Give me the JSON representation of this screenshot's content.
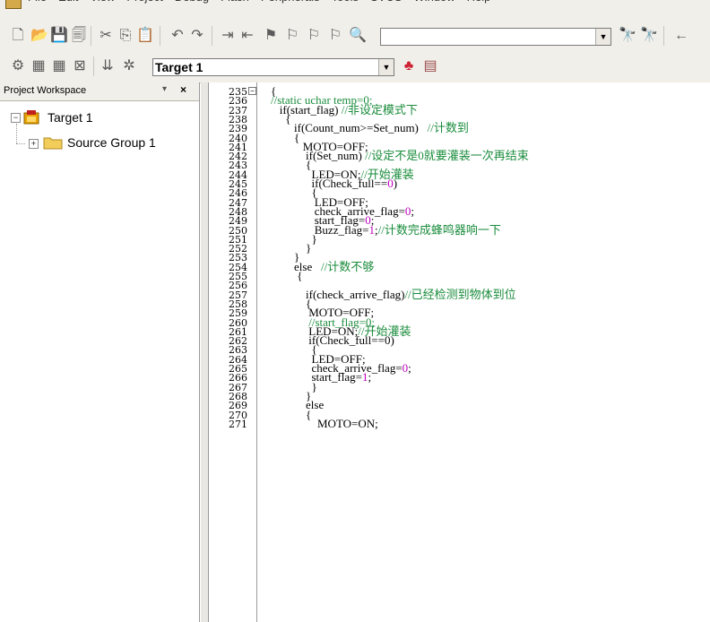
{
  "menu": [
    "File",
    "Edit",
    "View",
    "Project",
    "Debug",
    "Flash",
    "Peripherals",
    "Tools",
    "SVCS",
    "Window",
    "Help"
  ],
  "toolbar": {
    "target_combo": "Target 1",
    "search_combo": ""
  },
  "workspace": {
    "title": "Project Workspace",
    "pin": "▾",
    "close": "×",
    "tree": [
      {
        "label": "Target 1",
        "expander": "−"
      },
      {
        "label": "Source Group 1",
        "expander": "+"
      }
    ]
  },
  "editor": {
    "lines": [
      {
        "n": "235",
        "code": [
          {
            "t": "{",
            "c": "k"
          }
        ]
      },
      {
        "n": "236",
        "code": [
          {
            "t": "//static uchar temp=0;",
            "c": "c"
          }
        ]
      },
      {
        "n": "237",
        "code": [
          {
            "t": "   if(start_flag) ",
            "c": "k"
          },
          {
            "t": "//非设定模式下",
            "c": "c"
          }
        ]
      },
      {
        "n": "238",
        "code": [
          {
            "t": "     {",
            "c": "k"
          }
        ]
      },
      {
        "n": "239",
        "code": [
          {
            "t": "        if(Count_num>=Set_num)   ",
            "c": "k"
          },
          {
            "t": "//计数到",
            "c": "c"
          }
        ]
      },
      {
        "n": "240",
        "code": [
          {
            "t": "        {",
            "c": "k"
          }
        ]
      },
      {
        "n": "241",
        "code": [
          {
            "t": "           MOTO=OFF;",
            "c": "k"
          }
        ]
      },
      {
        "n": "242",
        "code": [
          {
            "t": "            if(Set_num) ",
            "c": "k"
          },
          {
            "t": "//设定不是0就要灌装一次再结束",
            "c": "c"
          }
        ]
      },
      {
        "n": "243",
        "code": [
          {
            "t": "            {",
            "c": "k"
          }
        ]
      },
      {
        "n": "244",
        "code": [
          {
            "t": "              LED=ON;",
            "c": "k"
          },
          {
            "t": "//开始灌装",
            "c": "c"
          }
        ]
      },
      {
        "n": "245",
        "code": [
          {
            "t": "              if(Check_full==",
            "c": "k"
          },
          {
            "t": "0",
            "c": "n"
          },
          {
            "t": ")",
            "c": "k"
          }
        ]
      },
      {
        "n": "246",
        "code": [
          {
            "t": "              {",
            "c": "k"
          }
        ]
      },
      {
        "n": "247",
        "code": [
          {
            "t": "               LED=OFF;",
            "c": "k"
          }
        ]
      },
      {
        "n": "248",
        "code": [
          {
            "t": "               check_arrive_flag=",
            "c": "k"
          },
          {
            "t": "0",
            "c": "n"
          },
          {
            "t": ";",
            "c": "k"
          }
        ]
      },
      {
        "n": "249",
        "code": [
          {
            "t": "               start_flag=",
            "c": "k"
          },
          {
            "t": "0",
            "c": "n"
          },
          {
            "t": ";",
            "c": "k"
          }
        ]
      },
      {
        "n": "250",
        "code": [
          {
            "t": "               Buzz_flag=",
            "c": "k"
          },
          {
            "t": "1",
            "c": "n"
          },
          {
            "t": ";",
            "c": "k"
          },
          {
            "t": "//计数完成蜂鸣器响一下",
            "c": "c"
          }
        ]
      },
      {
        "n": "251",
        "code": [
          {
            "t": "              }",
            "c": "k"
          }
        ]
      },
      {
        "n": "252",
        "code": [
          {
            "t": "            }",
            "c": "k"
          }
        ]
      },
      {
        "n": "253",
        "code": [
          {
            "t": "        }",
            "c": "k"
          }
        ]
      },
      {
        "n": "254",
        "code": [
          {
            "t": "        else   ",
            "c": "k"
          },
          {
            "t": "//计数不够",
            "c": "c"
          }
        ]
      },
      {
        "n": "255",
        "code": [
          {
            "t": "         {",
            "c": "k"
          }
        ]
      },
      {
        "n": "256",
        "code": []
      },
      {
        "n": "257",
        "code": [
          {
            "t": "            if(check_arrive_flag)",
            "c": "k"
          },
          {
            "t": "//已经检测到物体到位",
            "c": "c"
          }
        ]
      },
      {
        "n": "258",
        "code": [
          {
            "t": "            {",
            "c": "k"
          }
        ]
      },
      {
        "n": "259",
        "code": [
          {
            "t": "             MOTO=OFF;",
            "c": "k"
          }
        ]
      },
      {
        "n": "260",
        "code": [
          {
            "t": "             //start_flag=0;",
            "c": "c"
          }
        ]
      },
      {
        "n": "261",
        "code": [
          {
            "t": "             LED=ON;",
            "c": "k"
          },
          {
            "t": "//开始灌装",
            "c": "c"
          }
        ]
      },
      {
        "n": "262",
        "code": [
          {
            "t": "             if(Check_full==0)",
            "c": "k"
          }
        ]
      },
      {
        "n": "263",
        "code": [
          {
            "t": "              {",
            "c": "k"
          }
        ]
      },
      {
        "n": "264",
        "code": [
          {
            "t": "              LED=OFF;",
            "c": "k"
          }
        ]
      },
      {
        "n": "265",
        "code": [
          {
            "t": "              check_arrive_flag=",
            "c": "k"
          },
          {
            "t": "0",
            "c": "n"
          },
          {
            "t": ";",
            "c": "k"
          }
        ]
      },
      {
        "n": "266",
        "code": [
          {
            "t": "              start_flag=",
            "c": "k"
          },
          {
            "t": "1",
            "c": "n"
          },
          {
            "t": ";",
            "c": "k"
          }
        ]
      },
      {
        "n": "267",
        "code": [
          {
            "t": "              }",
            "c": "k"
          }
        ]
      },
      {
        "n": "268",
        "code": [
          {
            "t": "            }",
            "c": "k"
          }
        ]
      },
      {
        "n": "269",
        "code": [
          {
            "t": "            else",
            "c": "k"
          }
        ]
      },
      {
        "n": "270",
        "code": [
          {
            "t": "            {",
            "c": "k"
          }
        ]
      },
      {
        "n": "271",
        "code": [
          {
            "t": "                MOTO=ON;",
            "c": "k"
          }
        ]
      }
    ]
  }
}
